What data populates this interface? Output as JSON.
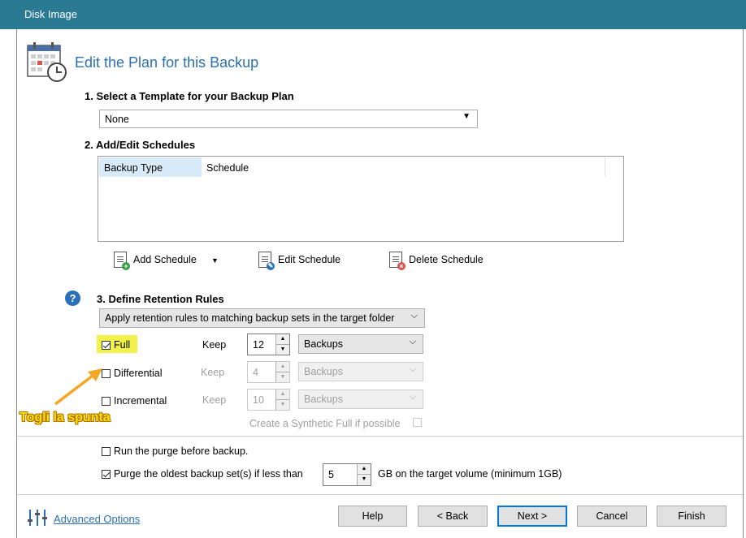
{
  "window": {
    "title": "Disk Image"
  },
  "heading": "Edit the Plan for this Backup",
  "section1": {
    "label": "1. Select a Template for your Backup Plan",
    "template_value": "None"
  },
  "section2": {
    "label": "2. Add/Edit Schedules",
    "columns": [
      "Backup Type",
      "Schedule"
    ],
    "add_label": "Add Schedule",
    "edit_label": "Edit Schedule",
    "delete_label": "Delete Schedule"
  },
  "section3": {
    "label": "3. Define Retention Rules",
    "rule_value": "Apply retention rules to matching backup sets in the target folder",
    "rows": [
      {
        "label": "Full",
        "checked": true,
        "keep_label": "Keep",
        "keep_value": "12",
        "unit": "Backups",
        "enabled": true
      },
      {
        "label": "Differential",
        "checked": false,
        "keep_label": "Keep",
        "keep_value": "4",
        "unit": "Backups",
        "enabled": false
      },
      {
        "label": "Incremental",
        "checked": false,
        "keep_label": "Keep",
        "keep_value": "10",
        "unit": "Backups",
        "enabled": false
      }
    ],
    "synthetic_label": "Create a Synthetic Full if possible"
  },
  "annotation": {
    "text": "Togli la spunta"
  },
  "purge": {
    "run_label": "Run the purge before backup.",
    "run_checked": false,
    "oldest_label": "Purge the oldest backup set(s) if less than",
    "oldest_checked": true,
    "gb_value": "5",
    "gb_suffix": "GB on the target volume (minimum 1GB)"
  },
  "footer": {
    "advanced_label": "Advanced Options",
    "buttons": {
      "help": "Help",
      "back": "< Back",
      "next": "Next >",
      "cancel": "Cancel",
      "finish": "Finish"
    }
  },
  "colors": {
    "titlebar": "#2b7a94",
    "heading": "#2b6fb6",
    "highlight": "#f2f24a",
    "annotation": "#f5a623"
  }
}
